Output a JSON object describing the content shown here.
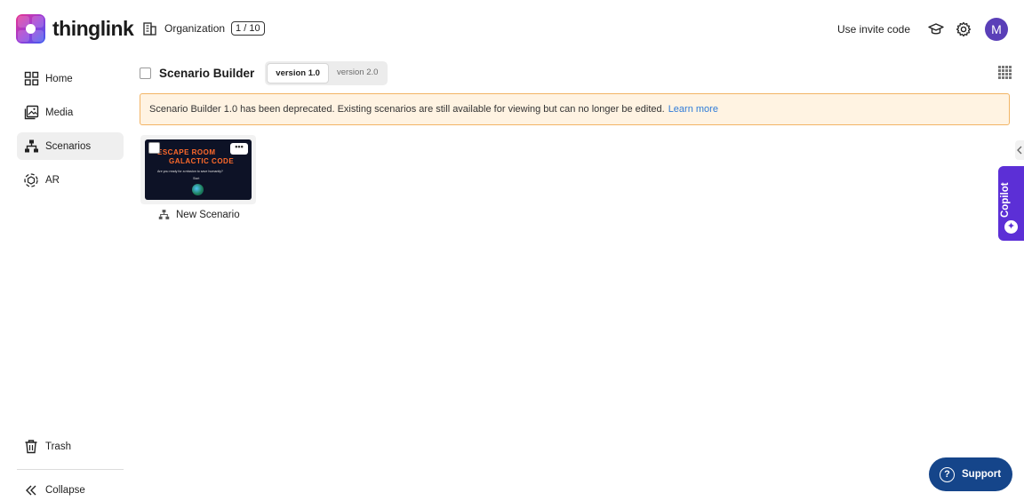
{
  "app": {
    "name": "thinglink"
  },
  "header": {
    "organization_label": "Organization",
    "organization_count": "1 / 10",
    "invite_label": "Use invite code",
    "avatar_initial": "M"
  },
  "sidebar": {
    "items": [
      {
        "label": "Home",
        "icon": "home-grid-icon",
        "active": false
      },
      {
        "label": "Media",
        "icon": "media-icon",
        "active": false
      },
      {
        "label": "Scenarios",
        "icon": "scenarios-icon",
        "active": true
      },
      {
        "label": "AR",
        "icon": "ar-icon",
        "active": false
      }
    ],
    "trash_label": "Trash",
    "collapse_label": "Collapse"
  },
  "main": {
    "title": "Scenario Builder",
    "versions": [
      {
        "label": "version 1.0",
        "selected": true
      },
      {
        "label": "version 2.0",
        "selected": false
      }
    ],
    "banner": {
      "text": "Scenario Builder 1.0 has been deprecated. Existing scenarios are still available for viewing but can no longer be edited.",
      "link": "Learn more"
    },
    "cards": [
      {
        "name": "New Scenario",
        "thumbnail_line1": "ESCAPE ROOM",
        "thumbnail_line2": "GALACTIC CODE",
        "thumbnail_subtitle": "Are you ready for a mission to save humanity?",
        "thumbnail_action": "Start"
      }
    ]
  },
  "right_rail": {
    "copilot_label": "Copilot"
  },
  "support": {
    "label": "Support"
  },
  "colors": {
    "accent_purple": "#5c2fd6",
    "support_blue": "#15458a",
    "banner_bg": "#fff3e2",
    "banner_border": "#f2b465",
    "link_blue": "#2f7bd8",
    "avatar": "#5a3fb8"
  }
}
